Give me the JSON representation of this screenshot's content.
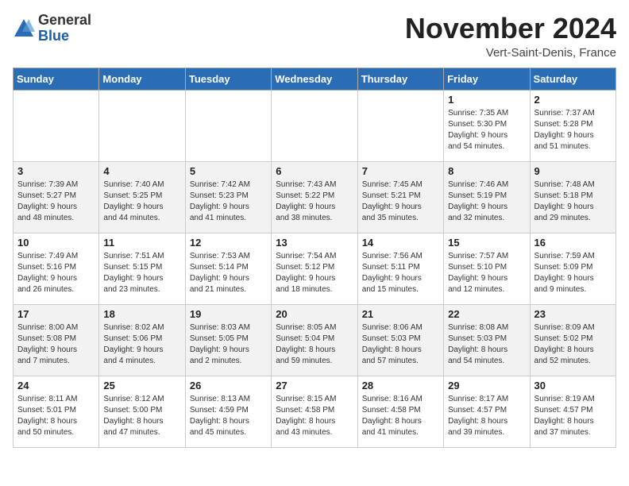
{
  "header": {
    "logo_line1": "General",
    "logo_line2": "Blue",
    "month": "November 2024",
    "location": "Vert-Saint-Denis, France"
  },
  "days_of_week": [
    "Sunday",
    "Monday",
    "Tuesday",
    "Wednesday",
    "Thursday",
    "Friday",
    "Saturday"
  ],
  "weeks": [
    [
      {
        "day": "",
        "info": ""
      },
      {
        "day": "",
        "info": ""
      },
      {
        "day": "",
        "info": ""
      },
      {
        "day": "",
        "info": ""
      },
      {
        "day": "",
        "info": ""
      },
      {
        "day": "1",
        "info": "Sunrise: 7:35 AM\nSunset: 5:30 PM\nDaylight: 9 hours\nand 54 minutes."
      },
      {
        "day": "2",
        "info": "Sunrise: 7:37 AM\nSunset: 5:28 PM\nDaylight: 9 hours\nand 51 minutes."
      }
    ],
    [
      {
        "day": "3",
        "info": "Sunrise: 7:39 AM\nSunset: 5:27 PM\nDaylight: 9 hours\nand 48 minutes."
      },
      {
        "day": "4",
        "info": "Sunrise: 7:40 AM\nSunset: 5:25 PM\nDaylight: 9 hours\nand 44 minutes."
      },
      {
        "day": "5",
        "info": "Sunrise: 7:42 AM\nSunset: 5:23 PM\nDaylight: 9 hours\nand 41 minutes."
      },
      {
        "day": "6",
        "info": "Sunrise: 7:43 AM\nSunset: 5:22 PM\nDaylight: 9 hours\nand 38 minutes."
      },
      {
        "day": "7",
        "info": "Sunrise: 7:45 AM\nSunset: 5:21 PM\nDaylight: 9 hours\nand 35 minutes."
      },
      {
        "day": "8",
        "info": "Sunrise: 7:46 AM\nSunset: 5:19 PM\nDaylight: 9 hours\nand 32 minutes."
      },
      {
        "day": "9",
        "info": "Sunrise: 7:48 AM\nSunset: 5:18 PM\nDaylight: 9 hours\nand 29 minutes."
      }
    ],
    [
      {
        "day": "10",
        "info": "Sunrise: 7:49 AM\nSunset: 5:16 PM\nDaylight: 9 hours\nand 26 minutes."
      },
      {
        "day": "11",
        "info": "Sunrise: 7:51 AM\nSunset: 5:15 PM\nDaylight: 9 hours\nand 23 minutes."
      },
      {
        "day": "12",
        "info": "Sunrise: 7:53 AM\nSunset: 5:14 PM\nDaylight: 9 hours\nand 21 minutes."
      },
      {
        "day": "13",
        "info": "Sunrise: 7:54 AM\nSunset: 5:12 PM\nDaylight: 9 hours\nand 18 minutes."
      },
      {
        "day": "14",
        "info": "Sunrise: 7:56 AM\nSunset: 5:11 PM\nDaylight: 9 hours\nand 15 minutes."
      },
      {
        "day": "15",
        "info": "Sunrise: 7:57 AM\nSunset: 5:10 PM\nDaylight: 9 hours\nand 12 minutes."
      },
      {
        "day": "16",
        "info": "Sunrise: 7:59 AM\nSunset: 5:09 PM\nDaylight: 9 hours\nand 9 minutes."
      }
    ],
    [
      {
        "day": "17",
        "info": "Sunrise: 8:00 AM\nSunset: 5:08 PM\nDaylight: 9 hours\nand 7 minutes."
      },
      {
        "day": "18",
        "info": "Sunrise: 8:02 AM\nSunset: 5:06 PM\nDaylight: 9 hours\nand 4 minutes."
      },
      {
        "day": "19",
        "info": "Sunrise: 8:03 AM\nSunset: 5:05 PM\nDaylight: 9 hours\nand 2 minutes."
      },
      {
        "day": "20",
        "info": "Sunrise: 8:05 AM\nSunset: 5:04 PM\nDaylight: 8 hours\nand 59 minutes."
      },
      {
        "day": "21",
        "info": "Sunrise: 8:06 AM\nSunset: 5:03 PM\nDaylight: 8 hours\nand 57 minutes."
      },
      {
        "day": "22",
        "info": "Sunrise: 8:08 AM\nSunset: 5:03 PM\nDaylight: 8 hours\nand 54 minutes."
      },
      {
        "day": "23",
        "info": "Sunrise: 8:09 AM\nSunset: 5:02 PM\nDaylight: 8 hours\nand 52 minutes."
      }
    ],
    [
      {
        "day": "24",
        "info": "Sunrise: 8:11 AM\nSunset: 5:01 PM\nDaylight: 8 hours\nand 50 minutes."
      },
      {
        "day": "25",
        "info": "Sunrise: 8:12 AM\nSunset: 5:00 PM\nDaylight: 8 hours\nand 47 minutes."
      },
      {
        "day": "26",
        "info": "Sunrise: 8:13 AM\nSunset: 4:59 PM\nDaylight: 8 hours\nand 45 minutes."
      },
      {
        "day": "27",
        "info": "Sunrise: 8:15 AM\nSunset: 4:58 PM\nDaylight: 8 hours\nand 43 minutes."
      },
      {
        "day": "28",
        "info": "Sunrise: 8:16 AM\nSunset: 4:58 PM\nDaylight: 8 hours\nand 41 minutes."
      },
      {
        "day": "29",
        "info": "Sunrise: 8:17 AM\nSunset: 4:57 PM\nDaylight: 8 hours\nand 39 minutes."
      },
      {
        "day": "30",
        "info": "Sunrise: 8:19 AM\nSunset: 4:57 PM\nDaylight: 8 hours\nand 37 minutes."
      }
    ]
  ]
}
